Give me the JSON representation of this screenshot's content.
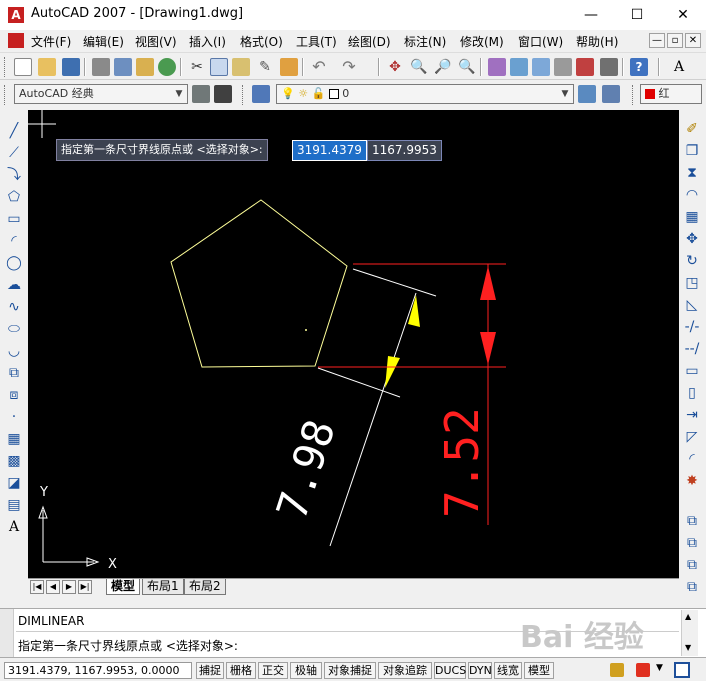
{
  "window": {
    "title": "AutoCAD 2007 - [Drawing1.dwg]",
    "app_icon": "A",
    "minimize": "—",
    "maximize": "☐",
    "close": "✕"
  },
  "menu": [
    "文件(F)",
    "编辑(E)",
    "视图(V)",
    "插入(I)",
    "格式(O)",
    "工具(T)",
    "绘图(D)",
    "标注(N)",
    "修改(M)",
    "窗口(W)",
    "帮助(H)"
  ],
  "mdi": [
    "—",
    "▫",
    "✕"
  ],
  "toolbar2": {
    "workspace": "AutoCAD 经典",
    "layer": "0",
    "color": "红"
  },
  "prompt": {
    "text": "指定第一条尺寸界线原点或 <选择对象>:",
    "x": "3191.4379",
    "y": "1167.9953"
  },
  "drawing": {
    "aligned_dim": "7.98",
    "linear_dim": "7.52",
    "y_label": "Y",
    "x_label": "X",
    "colors": {
      "pentagon": "#ffff99",
      "aligned": "#ffffff",
      "linear": "#ff2020",
      "arrow_yellow": "#ffff00"
    }
  },
  "tabs": {
    "nav": [
      "|◀",
      "◀",
      "▶",
      "▶|"
    ],
    "items": [
      "模型",
      "布局1",
      "布局2"
    ]
  },
  "command": {
    "line1": "DIMLINEAR",
    "line2": "指定第一条尺寸界线原点或 <选择对象>:"
  },
  "status": {
    "coords": "3191.4379, 1167.9953, 0.0000",
    "buttons": [
      "捕捉",
      "栅格",
      "正交",
      "极轴",
      "对象捕捉",
      "对象追踪",
      "DUCS",
      "DYN",
      "线宽",
      "模型"
    ]
  },
  "watermark": "Bai 经验"
}
